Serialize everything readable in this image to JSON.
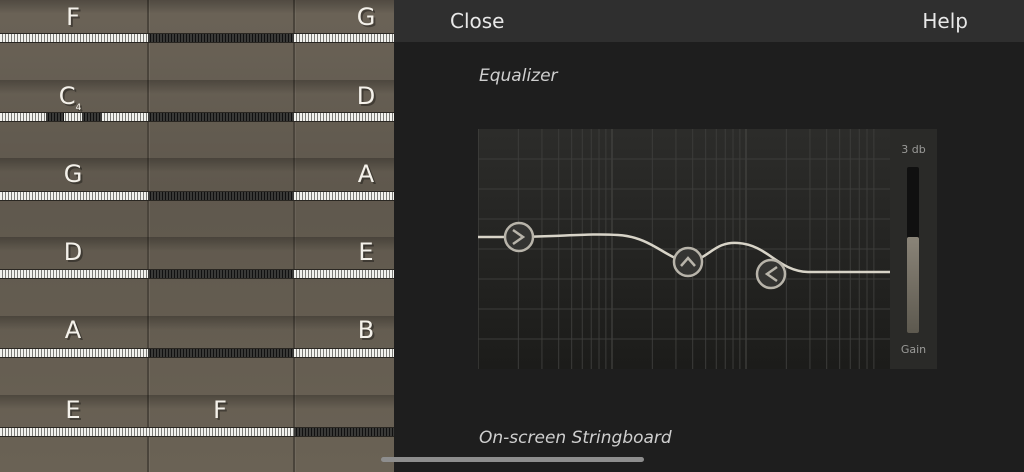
{
  "topbar": {
    "close_label": "Close",
    "help_label": "Help"
  },
  "equalizer": {
    "title": "Equalizer",
    "gain": {
      "db_label": "3 db",
      "label": "Gain",
      "level": 0.58
    },
    "bands": [
      {
        "name": "low-shelf",
        "icon": "chevron-right-icon"
      },
      {
        "name": "peak",
        "icon": "chevron-up-icon"
      },
      {
        "name": "high-shelf",
        "icon": "chevron-left-icon"
      }
    ]
  },
  "stringboard": {
    "title": "On-screen Stringboard"
  },
  "fretboard": {
    "strings": [
      {
        "open": "F",
        "fret1": "",
        "fret2": "G"
      },
      {
        "open": "C",
        "open_sub": "4",
        "fret1": "",
        "fret2": "D"
      },
      {
        "open": "G",
        "fret1": "",
        "fret2": "A"
      },
      {
        "open": "D",
        "fret1": "",
        "fret2": "E"
      },
      {
        "open": "A",
        "fret1": "",
        "fret2": "B"
      },
      {
        "open": "E",
        "fret1": "F",
        "fret2": ""
      }
    ]
  },
  "colors": {
    "background": "#1e1e1e",
    "topbar": "#2f2f2f",
    "curve": "#d8d4c8"
  }
}
